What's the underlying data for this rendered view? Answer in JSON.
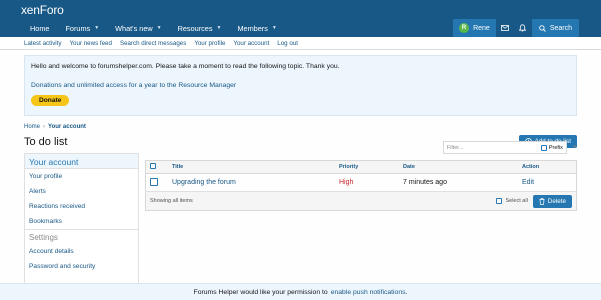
{
  "header": {
    "logo_text_a": "xen",
    "logo_text_b": "Foro"
  },
  "nav": {
    "items": [
      {
        "label": "Home"
      },
      {
        "label": "Forums"
      },
      {
        "label": "What's new"
      },
      {
        "label": "Resources"
      },
      {
        "label": "Members"
      }
    ],
    "user_initial": "R",
    "user_name": "Rene",
    "search_label": "Search"
  },
  "subnav": {
    "links": [
      "Latest activity",
      "Your news feed",
      "Search direct messages",
      "Your profile",
      "Your account",
      "Log out"
    ]
  },
  "notice": {
    "welcome": "Hello and welcome to forumshelper.com. Please take a moment to read the following topic. Thank you.",
    "donation_link": "Donations and unlimited access for a year to the Resource Manager",
    "donate_button": "Donate"
  },
  "breadcrumb": {
    "home": "Home",
    "current": "Your account"
  },
  "page": {
    "title": "To do list",
    "add_button": "Add to do list"
  },
  "sidebar": {
    "heading": "Your account",
    "items": [
      "Your profile",
      "Alerts",
      "Reactions received",
      "Bookmarks"
    ],
    "section": "Settings",
    "section_items": [
      "Account details",
      "Password and security"
    ]
  },
  "filter": {
    "placeholder": "Filter...",
    "prefix_label": "Prefix",
    "clear": "×"
  },
  "table": {
    "headers": {
      "title": "Title",
      "priority": "Priority",
      "date": "Date",
      "action": "Action"
    },
    "rows": [
      {
        "title": "Upgrading the forum",
        "priority": "High",
        "date": "7 minutes ago",
        "action": "Edit"
      }
    ],
    "footer_text": "Showing all items",
    "select_all": "Select all",
    "delete_button": "Delete"
  },
  "push": {
    "prefix": "Forums Helper would like your permission to",
    "link": "enable push notifications",
    "suffix": "."
  },
  "colors": {
    "brand": "#185886",
    "accent": "#2577b1",
    "priority_high": "#c7262c",
    "donate": "#f5c518"
  }
}
